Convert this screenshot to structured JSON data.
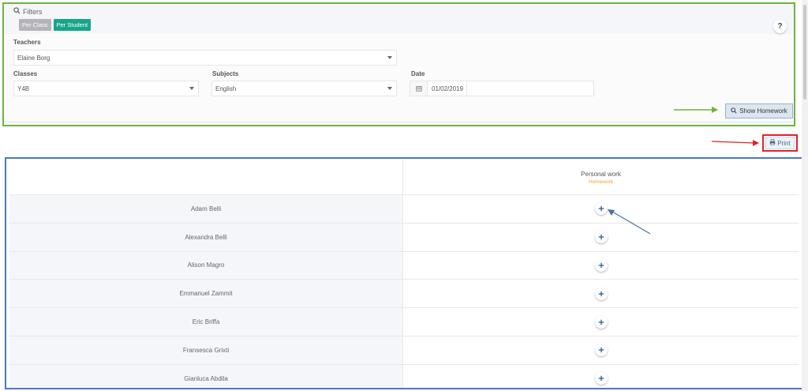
{
  "filters": {
    "title": "Filters",
    "toggles": [
      {
        "label": "Per Class",
        "active": false
      },
      {
        "label": "Per Student",
        "active": true
      }
    ],
    "help_label": "?",
    "teachers": {
      "label": "Teachers",
      "value": "Elaine Borg"
    },
    "classes": {
      "label": "Classes",
      "value": "Y4B"
    },
    "subjects": {
      "label": "Subjects",
      "value": "English"
    },
    "date": {
      "label": "Date",
      "value": "01/02/2019"
    },
    "show_button": "Show Homework"
  },
  "print_label": "Print",
  "table": {
    "column": {
      "title": "Personal work",
      "subtitle": "Homework"
    },
    "rows": [
      {
        "name": "Adam Belli"
      },
      {
        "name": "Alexandra Belli"
      },
      {
        "name": "Alison Magro"
      },
      {
        "name": "Emmanuel Zammit"
      },
      {
        "name": "Eric Briffa"
      },
      {
        "name": "Fransesca Grixti"
      },
      {
        "name": "Gianluca Abdila"
      }
    ]
  },
  "colors": {
    "filters_frame": "#6db33f",
    "print_frame": "#e0212b",
    "table_frame": "#4a78c8",
    "active_toggle": "#17a589",
    "homework_label": "#f39c3c"
  }
}
